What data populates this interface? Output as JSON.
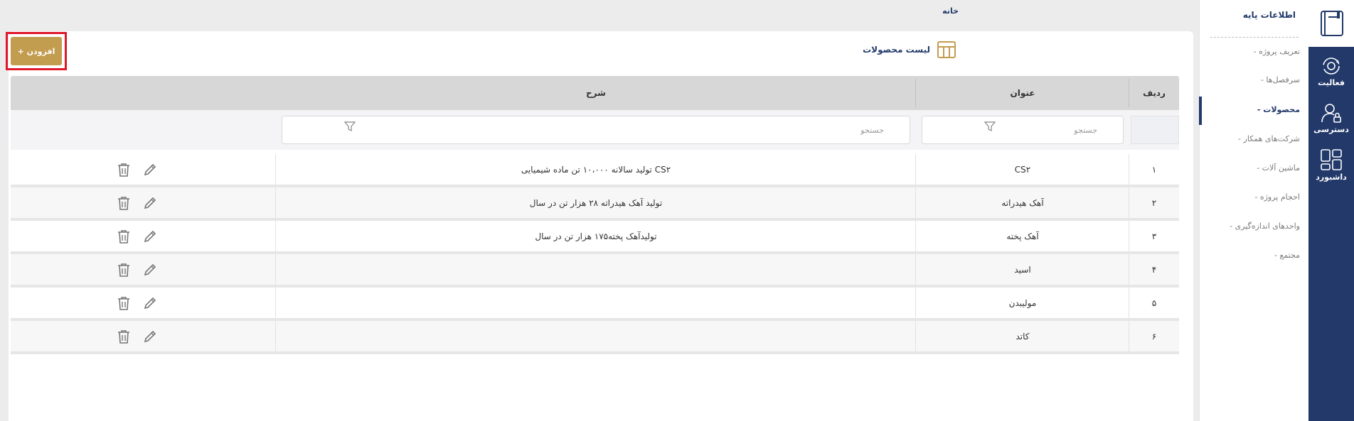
{
  "breadcrumb": "خانه",
  "rail": {
    "items": [
      {
        "label": "فعالیت",
        "icon": "gear-refresh-icon"
      },
      {
        "label": "دسترسی",
        "icon": "user-lock-icon"
      },
      {
        "label": "داشبورد",
        "icon": "dashboard-grid-icon"
      }
    ],
    "top_icon": "book-icon"
  },
  "submenu": {
    "title": "اطلاعات پایه",
    "items": [
      {
        "label": "- تعریف پروژه",
        "active": false
      },
      {
        "label": "- سرفصل‌ها",
        "active": false
      },
      {
        "label": "- محصولات",
        "active": true
      },
      {
        "label": "- شرکت‌های همکار",
        "active": false
      },
      {
        "label": "- ماشین آلات",
        "active": false
      },
      {
        "label": "- احجام پروژه",
        "active": false
      },
      {
        "label": "- واحدهای اندازه‌گیری",
        "active": false
      },
      {
        "label": "- مجتمع",
        "active": false
      }
    ]
  },
  "panel": {
    "title": "لیست محصولات",
    "add_label": "+ افزودن"
  },
  "table": {
    "headers": {
      "row": "ردیف",
      "title": "عنوان",
      "description": "شرح"
    },
    "search_placeholder": "جستجو",
    "rows": [
      {
        "num": "۱",
        "title": "CS۲",
        "desc": "تولید سالانه ۱۰،۰۰۰ تن ماده شیمیایی CS۲"
      },
      {
        "num": "۲",
        "title": "آهک هیدراته",
        "desc": "تولید آهک هیدراته ۲۸ هزار تن در سال"
      },
      {
        "num": "۳",
        "title": "آهک پخته",
        "desc": "تولیدآهک پخته۱۷۵ هزار تن در سال"
      },
      {
        "num": "۴",
        "title": "اسید",
        "desc": ""
      },
      {
        "num": "۵",
        "title": "مولیبدن",
        "desc": ""
      },
      {
        "num": "۶",
        "title": "کاتد",
        "desc": ""
      }
    ]
  },
  "colors": {
    "navy": "#22396a",
    "gold": "#c29c4f",
    "highlight": "#e0182a"
  }
}
